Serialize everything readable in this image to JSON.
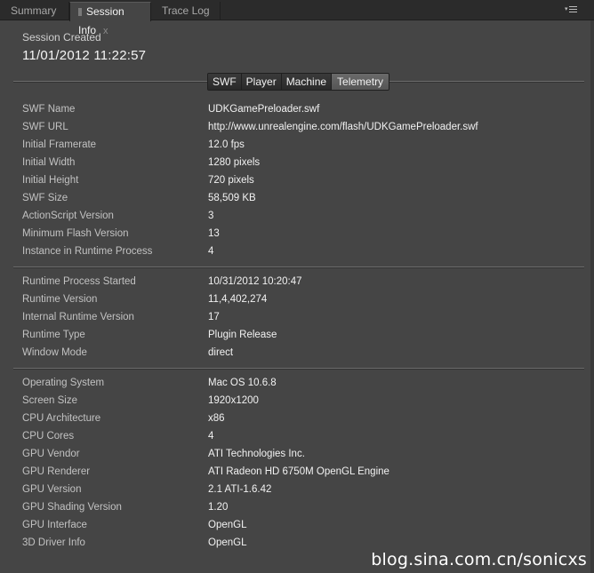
{
  "tabs": [
    {
      "label": "Summary",
      "active": false
    },
    {
      "label": "Session Info",
      "active": true
    },
    {
      "label": "Trace Log",
      "active": false
    }
  ],
  "tab_close_glyph": "x",
  "session": {
    "created_label": "Session Created",
    "created_value": "11/01/2012 11:22:57"
  },
  "segments": [
    {
      "label": "SWF",
      "active": false
    },
    {
      "label": "Player",
      "active": false
    },
    {
      "label": "Machine",
      "active": false
    },
    {
      "label": "Telemetry",
      "active": true
    }
  ],
  "groups": [
    {
      "rows": [
        {
          "key": "SWF Name",
          "value": "UDKGamePreloader.swf"
        },
        {
          "key": "SWF URL",
          "value": "http://www.unrealengine.com/flash/UDKGamePreloader.swf"
        },
        {
          "key": "Initial Framerate",
          "value": "12.0 fps"
        },
        {
          "key": "Initial Width",
          "value": "1280 pixels"
        },
        {
          "key": "Initial Height",
          "value": "720 pixels"
        },
        {
          "key": "SWF Size",
          "value": "58,509 KB"
        },
        {
          "key": "ActionScript Version",
          "value": "3"
        },
        {
          "key": "Minimum Flash Version",
          "value": "13"
        },
        {
          "key": "Instance in Runtime Process",
          "value": "4"
        }
      ]
    },
    {
      "rows": [
        {
          "key": "Runtime Process Started",
          "value": "10/31/2012 10:20:47"
        },
        {
          "key": "Runtime Version",
          "value": "11,4,402,274"
        },
        {
          "key": "Internal Runtime Version",
          "value": "17"
        },
        {
          "key": "Runtime Type",
          "value": "Plugin Release"
        },
        {
          "key": "Window Mode",
          "value": "direct"
        }
      ]
    },
    {
      "rows": [
        {
          "key": "Operating System",
          "value": "Mac OS 10.6.8"
        },
        {
          "key": "Screen Size",
          "value": "1920x1200"
        },
        {
          "key": "CPU Architecture",
          "value": "x86"
        },
        {
          "key": "CPU Cores",
          "value": "4"
        },
        {
          "key": "GPU Vendor",
          "value": "ATI Technologies Inc."
        },
        {
          "key": "GPU Renderer",
          "value": "ATI Radeon HD 6750M OpenGL Engine"
        },
        {
          "key": "GPU Version",
          "value": "2.1 ATI-1.6.42"
        },
        {
          "key": "GPU Shading Version",
          "value": "1.20"
        },
        {
          "key": "GPU Interface",
          "value": "OpenGL"
        },
        {
          "key": "3D Driver Info",
          "value": "OpenGL"
        }
      ]
    }
  ],
  "watermark": "blog.sina.com.cn/sonicxs",
  "icons": {
    "panel_menu": "panel-menu-icon",
    "tab_grip": "grip-icon"
  }
}
